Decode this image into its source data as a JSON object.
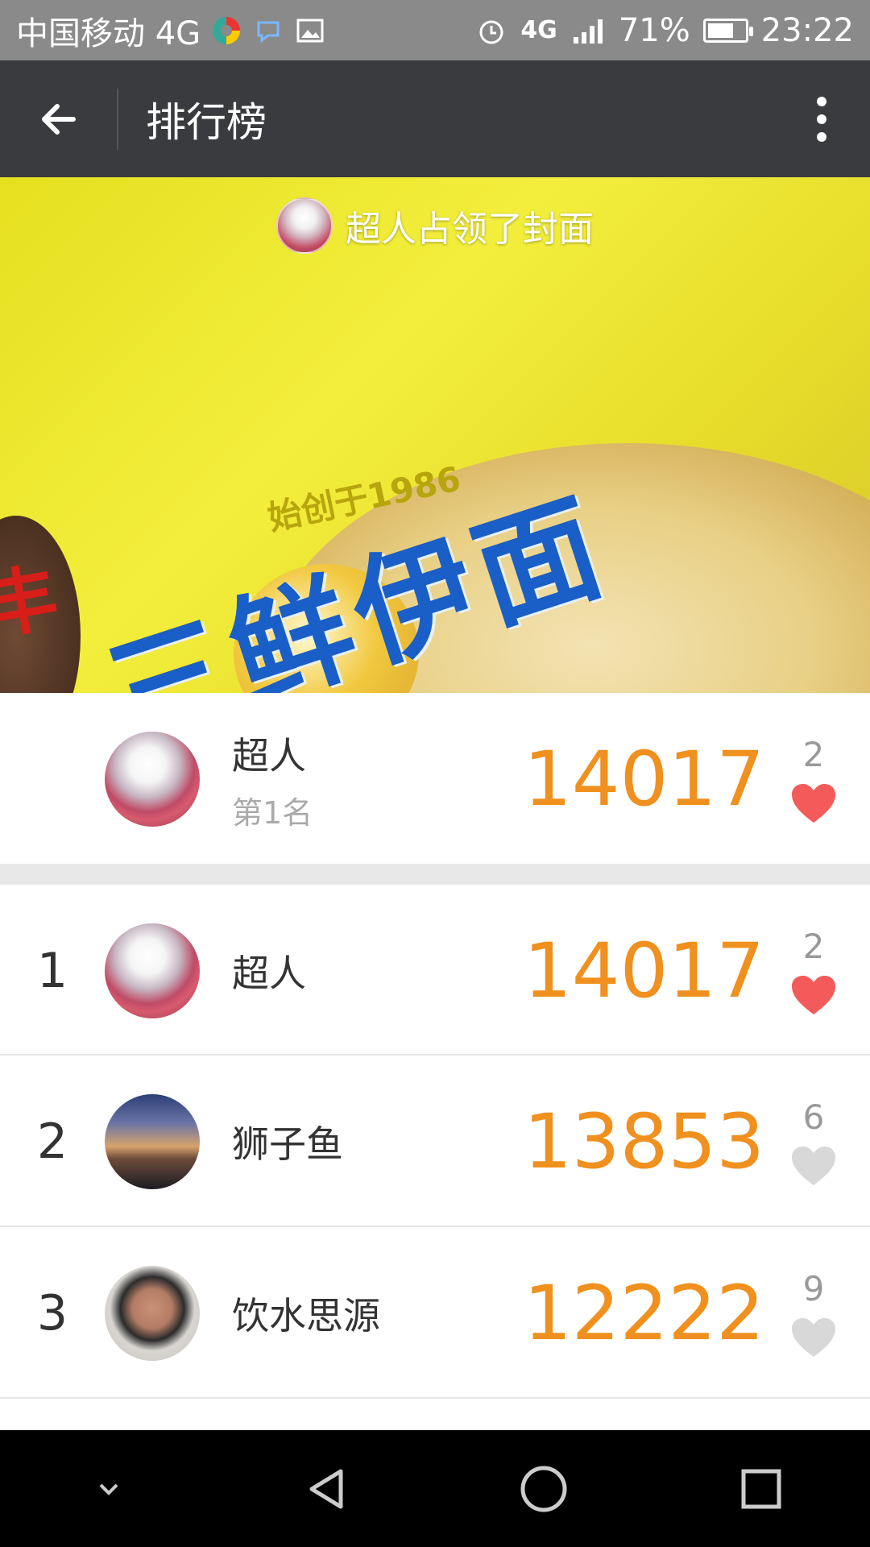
{
  "status_bar": {
    "carrier": "中国移动 4G",
    "network": "4G",
    "battery": "71%",
    "battery_level": 0.71,
    "time": "23:22"
  },
  "toolbar": {
    "title": "排行榜"
  },
  "cover": {
    "caption": "超人占领了封面",
    "package_brand": "三鲜伊面",
    "package_brand_prefix": "丰",
    "package_since": "始创于1986"
  },
  "me": {
    "name": "超人",
    "rank_text": "第1名",
    "score": "14017",
    "likes": "2",
    "liked": true
  },
  "leaderboard": [
    {
      "rank": "1",
      "name": "超人",
      "score": "14017",
      "likes": "2",
      "liked": true,
      "avatar": "cat-avatar"
    },
    {
      "rank": "2",
      "name": "狮子鱼",
      "score": "13853",
      "likes": "6",
      "liked": false,
      "avatar": "sunset-avatar"
    },
    {
      "rank": "3",
      "name": "饮水思源",
      "score": "12222",
      "likes": "9",
      "liked": false,
      "avatar": "person-avatar"
    }
  ],
  "colors": {
    "score": "#f0901e",
    "heart_liked": "#f45a5a",
    "heart_unliked": "#d8d8d8",
    "toolbar": "#3a3b3f"
  }
}
